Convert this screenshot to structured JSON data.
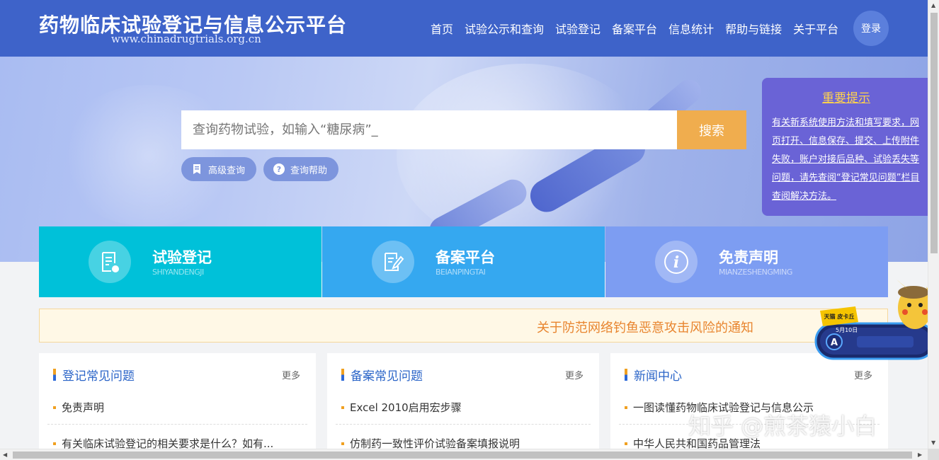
{
  "header": {
    "title": "药物临床试验登记与信息公示平台",
    "url": "www.chinadrugtrials.org.cn",
    "nav": [
      "首页",
      "试验公示和查询",
      "试验登记",
      "备案平台",
      "信息统计",
      "帮助与链接",
      "关于平台"
    ],
    "login": "登录"
  },
  "search": {
    "placeholder": "查询药物试验，如输入“糖尿病”_",
    "button": "搜索",
    "advanced": "高级查询",
    "help": "查询帮助"
  },
  "notice": {
    "title": "重要提示",
    "body": "有关新系统使用方法和填写要求，网页打开、信息保存、提交、上传附件失败，账户对接后品种、试验丢失等问题，请先查阅“登记常见问题”栏目查阅解决方法。"
  },
  "tiles": [
    {
      "title": "试验登记",
      "sub": "SHIYANDENGJI",
      "color": "#00c1d9",
      "icon": "document-edit-icon"
    },
    {
      "title": "备案平台",
      "sub": "BEIANPINGTAI",
      "color": "#35a8f0",
      "icon": "pen-paper-icon"
    },
    {
      "title": "免责声明",
      "sub": "MIANZESHENGMING",
      "color": "#7d9df2",
      "icon": "info-icon"
    }
  ],
  "alert": "关于防范网络钓鱼恶意攻击风险的通知",
  "columns": [
    {
      "title": "登记常见问题",
      "more": "更多",
      "items": [
        "免责声明",
        "有关临床试验登记的相关要求是什么？如有..."
      ]
    },
    {
      "title": "备案常见问题",
      "more": "更多",
      "items": [
        "Excel 2010启用宏步骤",
        "仿制药一致性评价试验备案填报说明"
      ]
    },
    {
      "title": "新闻中心",
      "more": "更多",
      "items": [
        "一图读懂药物临床试验登记与信息公示",
        "中华人民共和国药品管理法"
      ]
    }
  ],
  "watermark": "知乎 @煎茶猿小白",
  "ad": {
    "badge": "天猫 皮卡丘",
    "date": "5月10日"
  }
}
